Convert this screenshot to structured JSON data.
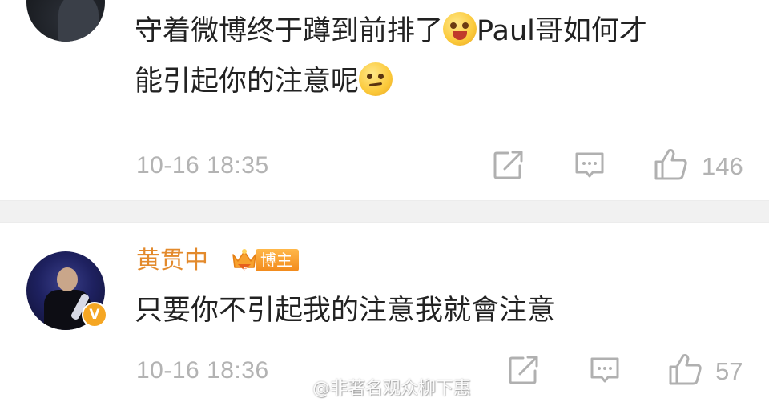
{
  "comments": [
    {
      "text_line1": "守着微博终于蹲到前排了",
      "text_line1_after": "Paul哥如何才",
      "text_line2": "能引起你的注意呢",
      "emoji1": "flower-eyes-emoji",
      "emoji2": "thinking-emoji",
      "timestamp": "10-16 18:35",
      "like_count": "146"
    },
    {
      "username": "黄贯中",
      "badge_label": "博主",
      "verified_label": "V",
      "text": "只要你不引起我的注意我就會注意",
      "timestamp": "10-16 18:36",
      "like_count": "57"
    }
  ],
  "watermark": {
    "text": "@非著名观众柳下惠"
  },
  "colors": {
    "username": "#e38a2c",
    "meta_text": "#b3b3b3",
    "divider": "#f1f1f1",
    "badge": "#f28a1c",
    "verified": "#f5a623"
  },
  "icons": [
    "share-icon",
    "comment-icon",
    "like-icon",
    "crown-icon",
    "weibo-logo-icon"
  ]
}
